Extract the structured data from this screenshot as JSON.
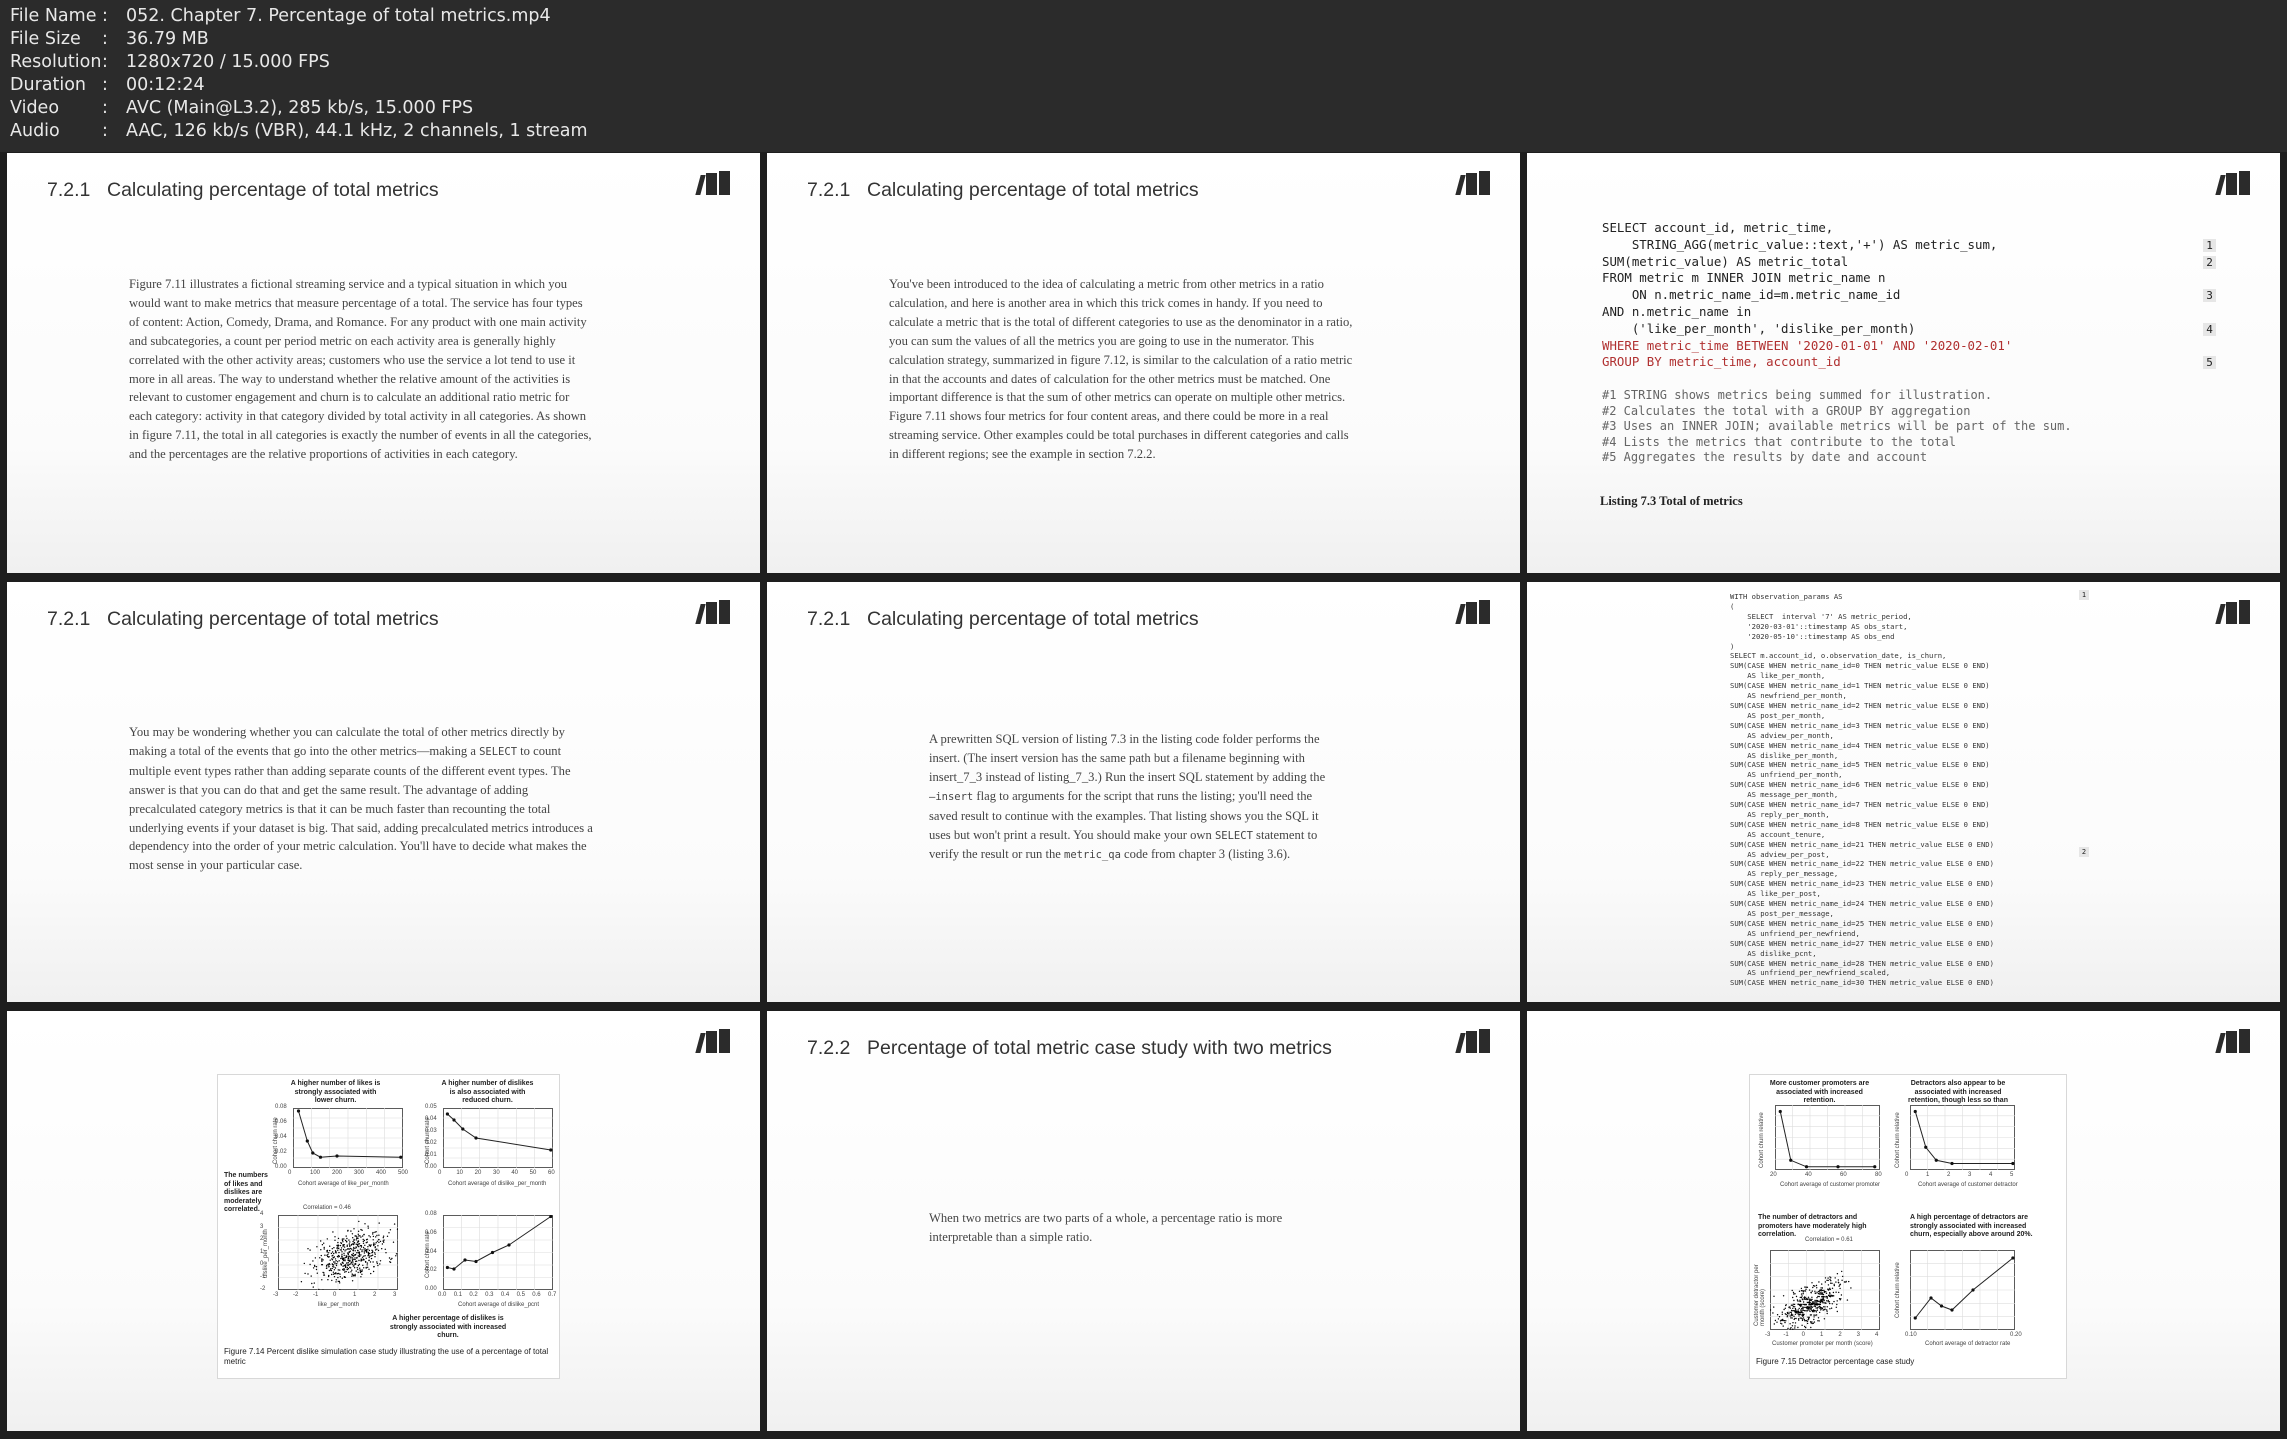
{
  "header": {
    "rows": [
      {
        "key": "File Name",
        "value": "052. Chapter 7. Percentage of total metrics.mp4"
      },
      {
        "key": "File Size",
        "value": "36.79 MB"
      },
      {
        "key": "Resolution",
        "value": "1280x720 / 15.000 FPS"
      },
      {
        "key": "Duration",
        "value": "00:12:24"
      },
      {
        "key": "Video",
        "value": "AVC (Main@L3.2), 285 kb/s, 15.000 FPS"
      },
      {
        "key": "Audio",
        "value": "AAC, 126 kb/s (VBR), 44.1 kHz, 2 channels, 1 stream"
      }
    ],
    "separator": ":"
  },
  "thumbs": {
    "t1": {
      "num": "7.2.1",
      "title": "Calculating percentage of total metrics",
      "lines": [
        "Figure 7.11 illustrates a fictional streaming service and a typical situation in which you",
        "would want to make metrics that measure percentage of a total. The service has four types",
        "of content: Action, Comedy, Drama, and Romance. For any product with one main activity",
        "and subcategories, a count per period metric on each activity area is generally highly",
        "correlated with the other activity areas; customers who use the service a lot tend to use it",
        "more in all areas. The way to understand whether the relative amount of the activities is",
        "relevant to customer engagement and churn is to calculate an additional ratio metric for",
        "each category: activity in that category divided by total activity in all categories. As shown",
        "in figure 7.11, the total in all categories is exactly the number of events in all the categories,",
        "and the percentages are the relative proportions of activities in each category."
      ]
    },
    "t2": {
      "num": "7.2.1",
      "title": "Calculating percentage of total metrics",
      "lines": [
        "You've been introduced to the idea of calculating a metric from other metrics in a ratio",
        "calculation, and here is another area in which this trick comes in handy. If you need to",
        "calculate a metric that is the total of different categories to use as the denominator in a ratio,",
        "you can sum the values of all the metrics you are going to use in the numerator. This",
        "calculation strategy, summarized in figure 7.12, is similar to the calculation of a ratio metric",
        "in that the accounts and dates of calculation for the other metrics must be matched. One",
        "important difference is that the sum of other metrics can operate on multiple other metrics.",
        "Figure 7.11 shows four metrics for four content areas, and there could be more in a real",
        "streaming service. Other examples could be total purchases in different categories and calls",
        "in different regions; see the example in section 7.2.2."
      ]
    },
    "t3": {
      "code": [
        {
          "text": "SELECT account_id, metric_time,",
          "kw": false,
          "callout": ""
        },
        {
          "text": "    STRING_AGG(metric_value::text,'+') AS metric_sum,",
          "kw": false,
          "callout": "1"
        },
        {
          "text": "SUM(metric_value) AS metric_total",
          "kw": false,
          "callout": "2"
        },
        {
          "text": "FROM metric m INNER JOIN metric_name n",
          "kw": false,
          "callout": ""
        },
        {
          "text": "    ON n.metric_name_id=m.metric_name_id",
          "kw": false,
          "callout": "3"
        },
        {
          "text": "AND n.metric_name in",
          "kw": false,
          "callout": ""
        },
        {
          "text": "    ('like_per_month', 'dislike_per_month)",
          "kw": false,
          "callout": "4"
        },
        {
          "text": "WHERE metric_time BETWEEN '2020-01-01' AND '2020-02-01'",
          "kw": true,
          "callout": ""
        },
        {
          "text": "GROUP BY metric_time, account_id",
          "kw": true,
          "callout": "5"
        }
      ],
      "comments": [
        "#1 STRING shows metrics being summed for illustration.",
        "#2 Calculates the total with a GROUP BY aggregation",
        "#3 Uses an INNER JOIN; available metrics will be part of the sum.",
        "#4 Lists the metrics that contribute to the total",
        "#5 Aggregates the results by date and account"
      ],
      "caption": "Listing 7.3 Total of metrics"
    },
    "t4": {
      "num": "7.2.1",
      "title": "Calculating percentage of total metrics",
      "lines": [
        "You may be wondering whether you can calculate the total of other metrics directly by",
        "making a total of the events that go into the other metrics—making a [SELECT] to count",
        "multiple event types rather than adding separate counts of the different event types. The",
        "answer is that you can do that and get the same result. The advantage of adding",
        "precalculated category metrics is that it can be much faster than recounting the total",
        "underlying events if your dataset is big. That said, adding precalculated metrics introduces a",
        "dependency into the order of your metric calculation. You'll have to decide what makes the",
        "most sense in your particular case."
      ]
    },
    "t5": {
      "num": "7.2.1",
      "title": "Calculating percentage of total metrics",
      "lines": [
        "A prewritten SQL version of listing 7.3 in the listing code folder performs the",
        "insert. (The insert version has the same path but a filename beginning with",
        "insert_7_3 instead of listing_7_3.) Run the insert SQL statement by adding the",
        "[–insert] flag to arguments for the script that runs the listing; you'll need the",
        "saved result to continue with the examples. That listing shows you the SQL it",
        "uses but won't print a result. You should make your own [SELECT] statement to",
        "verify the result or run the [metric_qa] code from chapter 3 (listing 3.6)."
      ]
    },
    "t6": {
      "code": [
        "WITH observation_params AS",
        "(",
        "    SELECT  interval '7' AS metric_period,",
        "    '2020-03-01'::timestamp AS obs_start,",
        "    '2020-05-10'::timestamp AS obs_end",
        ")",
        "SELECT m.account_id, o.observation_date, is_churn,",
        "SUM(CASE WHEN metric_name_id=0 THEN metric_value ELSE 0 END)",
        "    AS like_per_month,",
        "SUM(CASE WHEN metric_name_id=1 THEN metric_value ELSE 0 END)",
        "    AS newfriend_per_month,",
        "SUM(CASE WHEN metric_name_id=2 THEN metric_value ELSE 0 END)",
        "    AS post_per_month,",
        "SUM(CASE WHEN metric_name_id=3 THEN metric_value ELSE 0 END)",
        "    AS adview_per_month,",
        "SUM(CASE WHEN metric_name_id=4 THEN metric_value ELSE 0 END)",
        "    AS dislike_per_month,",
        "SUM(CASE WHEN metric_name_id=5 THEN metric_value ELSE 0 END)",
        "    AS unfriend_per_month,",
        "SUM(CASE WHEN metric_name_id=6 THEN metric_value ELSE 0 END)",
        "    AS message_per_month,",
        "SUM(CASE WHEN metric_name_id=7 THEN metric_value ELSE 0 END)",
        "    AS reply_per_month,",
        "SUM(CASE WHEN metric_name_id=8 THEN metric_value ELSE 0 END)",
        "    AS account_tenure,",
        "SUM(CASE WHEN metric_name_id=21 THEN metric_value ELSE 0 END)",
        "    AS adview_per_post,",
        "SUM(CASE WHEN metric_name_id=22 THEN metric_value ELSE 0 END)",
        "    AS reply_per_message,",
        "SUM(CASE WHEN metric_name_id=23 THEN metric_value ELSE 0 END)",
        "    AS like_per_post,",
        "SUM(CASE WHEN metric_name_id=24 THEN metric_value ELSE 0 END)",
        "    AS post_per_message,",
        "SUM(CASE WHEN metric_name_id=25 THEN metric_value ELSE 0 END)",
        "    AS unfriend_per_newfriend,",
        "SUM(CASE WHEN metric_name_id=27 THEN metric_value ELSE 0 END)",
        "    AS dislike_pcnt,",
        "SUM(CASE WHEN metric_name_id=28 THEN metric_value ELSE 0 END)",
        "    AS unfriend_per_newfriend_scaled,",
        "SUM(CASE WHEN metric_name_id=30 THEN metric_value ELSE 0 END)"
      ],
      "callout1": "1",
      "callout2": "2"
    },
    "t7": {
      "t_likes": "A higher number of likes is strongly associated with lower churn.",
      "t_dislikes": "A higher number of dislikes is also associated with reduced churn.",
      "t_numbers": "The numbers of likes and dislikes are moderately correlated.",
      "t_pct": "A higher percentage of dislikes is strongly associated with increased churn.",
      "corr": "Correlation = 0.46",
      "x1": "Cohort average of like_per_month",
      "x2": "Cohort average of dislike_per_month",
      "x3": "like_per_month",
      "x4": "Cohort average of dislike_pcnt",
      "y1": "Cohort churn rate",
      "y3": "dislike_per_month",
      "ticks_x1": [
        "0",
        "100",
        "200",
        "300",
        "400",
        "500"
      ],
      "ticks_y1": [
        "0.08",
        "0.06",
        "0.04",
        "0.02",
        "0.00"
      ],
      "ticks_x2": [
        "0",
        "10",
        "20",
        "30",
        "40",
        "50",
        "60"
      ],
      "ticks_y2": [
        "0.05",
        "0.04",
        "0.03",
        "0.02",
        "0.01",
        "0.00"
      ],
      "ticks_x3": [
        "-3",
        "-2",
        "-1",
        "0",
        "1",
        "2",
        "3"
      ],
      "ticks_y3": [
        "4",
        "3",
        "2",
        "1",
        "0",
        "-1",
        "-2"
      ],
      "ticks_x4": [
        "0.0",
        "0.1",
        "0.2",
        "0.3",
        "0.4",
        "0.5",
        "0.6",
        "0.7"
      ],
      "ticks_y4": [
        "0.08",
        "0.06",
        "0.04",
        "0.02",
        "0.00"
      ],
      "caption": "Figure 7.14 Percent dislike simulation case study illustrating the use of a percentage of total metric"
    },
    "t8": {
      "num": "7.2.2",
      "title": "Percentage of total metric case study with two metrics",
      "lines": [
        "When two metrics are two parts of a whole, a percentage ratio is more",
        "interpretable than a simple ratio."
      ]
    },
    "t9": {
      "t_promoters": "More customer promoters are associated with increased retention.",
      "t_detractors": "Detractors also appear to be associated with increased retention, though less so than promoters.",
      "t_corr_note": "The number of detractors and promoters have moderately high correlation.",
      "t_high": "A high percentage of detractors are strongly associated with increased churn, especially above around 20%.",
      "corr": "Correlation = 0.61",
      "x1": "Cohort average of customer promoter",
      "x2": "Cohort average of customer detractor",
      "x3": "Customer promoter per month (score)",
      "x4": "Cohort average of detractor rate",
      "y1": "Cohort churn relative",
      "y3": "Customer detractor per month (score)",
      "ticks_x1": [
        "20",
        "40",
        "60",
        "80"
      ],
      "ticks_x2": [
        "0",
        "1",
        "2",
        "3",
        "4",
        "5"
      ],
      "ticks_x3": [
        "-3",
        "-1",
        "0",
        "1",
        "2",
        "3",
        "4"
      ],
      "ticks_x4": [
        "0.10",
        "0.20"
      ],
      "caption": "Figure 7.15 Detractor percentage case study"
    },
    "common": {
      "logo": "manning-logo-icon"
    }
  }
}
